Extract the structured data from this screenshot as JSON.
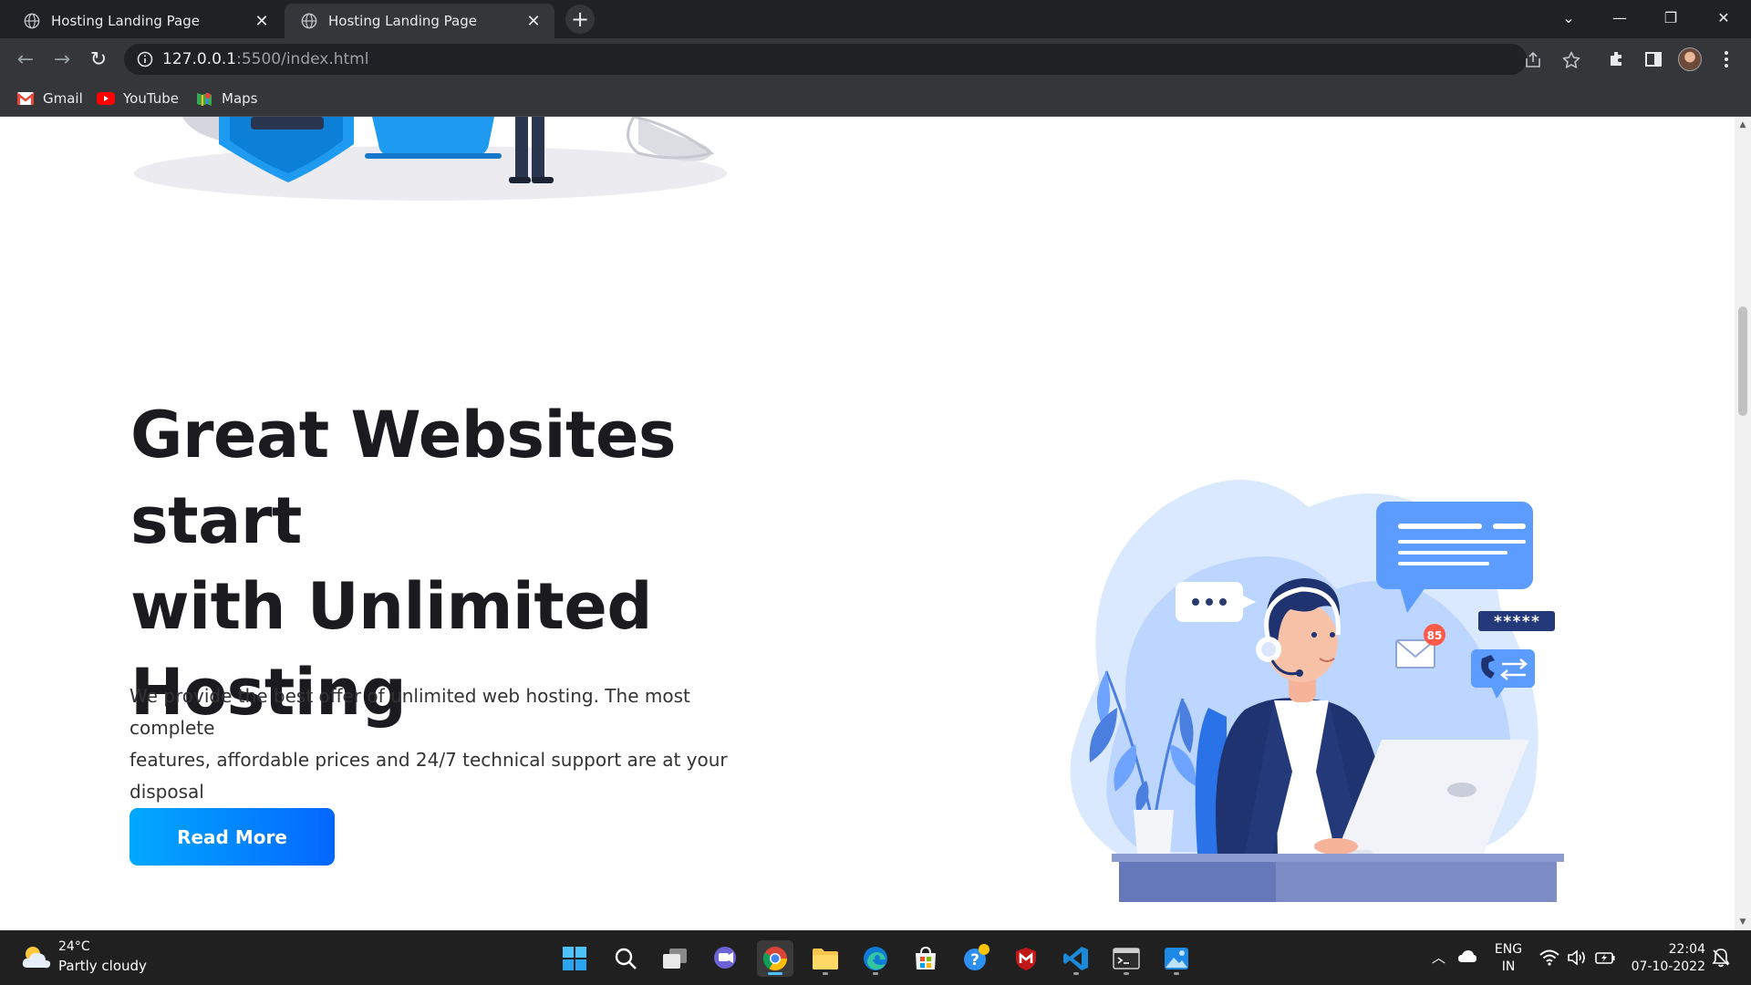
{
  "browser": {
    "tabs": [
      {
        "title": "Hosting Landing Page",
        "active": false
      },
      {
        "title": "Hosting Landing Page",
        "active": true
      }
    ],
    "address": {
      "host": "127.0.0.1",
      "rest": ":5500/index.html"
    },
    "bookmarks": [
      {
        "label": "Gmail",
        "icon": "gmail-icon"
      },
      {
        "label": "YouTube",
        "icon": "youtube-icon"
      },
      {
        "label": "Maps",
        "icon": "maps-icon"
      }
    ]
  },
  "page": {
    "hero": {
      "title_lines": [
        "Great Websites start",
        "with Unlimited",
        "Hosting"
      ],
      "text_lines": [
        "We provide the best offer of unlimited web hosting. The most complete",
        "features, affordable prices and 24/7 technical support are at your",
        "disposal"
      ],
      "cta": "Read More"
    },
    "illustration": {
      "badge": "85",
      "password_mask": "*****"
    }
  },
  "taskbar": {
    "weather": {
      "temp": "24°C",
      "desc": "Partly cloudy"
    },
    "lang": {
      "line1": "ENG",
      "line2": "IN"
    },
    "clock": {
      "time": "22:04",
      "date": "07-10-2022"
    }
  },
  "colors": {
    "accent_start": "#01a9ff",
    "accent_end": "#0466ff",
    "heading": "#1b1b1f",
    "illustration_blue": "#5c9cff"
  }
}
